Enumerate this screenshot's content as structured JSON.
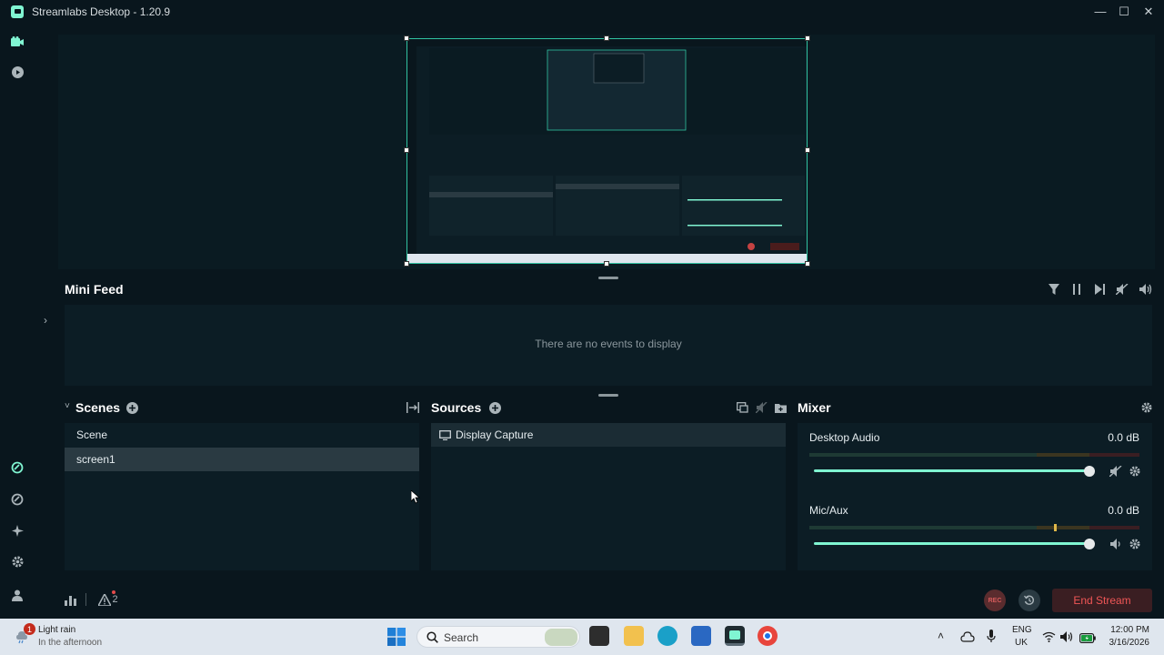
{
  "window": {
    "title": "Streamlabs Desktop - 1.20.9",
    "minimize": "—",
    "maximize": "☐",
    "close": "✕"
  },
  "mini_feed": {
    "title": "Mini Feed",
    "empty_message": "There are no events to display"
  },
  "scenes": {
    "title": "Scenes",
    "collapse_glyph": "˅",
    "items": [
      "Scene",
      "screen1"
    ],
    "selected_index": 1
  },
  "sources": {
    "title": "Sources",
    "items": [
      "Display Capture"
    ]
  },
  "mixer": {
    "title": "Mixer",
    "channels": [
      {
        "name": "Desktop Audio",
        "db": "0.0 dB",
        "volume": 1.0
      },
      {
        "name": "Mic/Aux",
        "db": "0.0 dB",
        "volume": 1.0
      }
    ]
  },
  "bottom": {
    "rec_label": "REC",
    "end_stream_label": "End Stream",
    "alert_count": "2"
  },
  "taskbar": {
    "weather_line1": "Light rain",
    "weather_line2": "In the afternoon",
    "weather_badge": "1",
    "search_label": "Search",
    "lang_line1": "ENG",
    "lang_line2": "UK",
    "time": "12:00 PM",
    "date": "3/16/2026"
  },
  "colors": {
    "accent": "#80f5d2",
    "end_stream": "#e34b4b",
    "rec": "#c44242"
  }
}
